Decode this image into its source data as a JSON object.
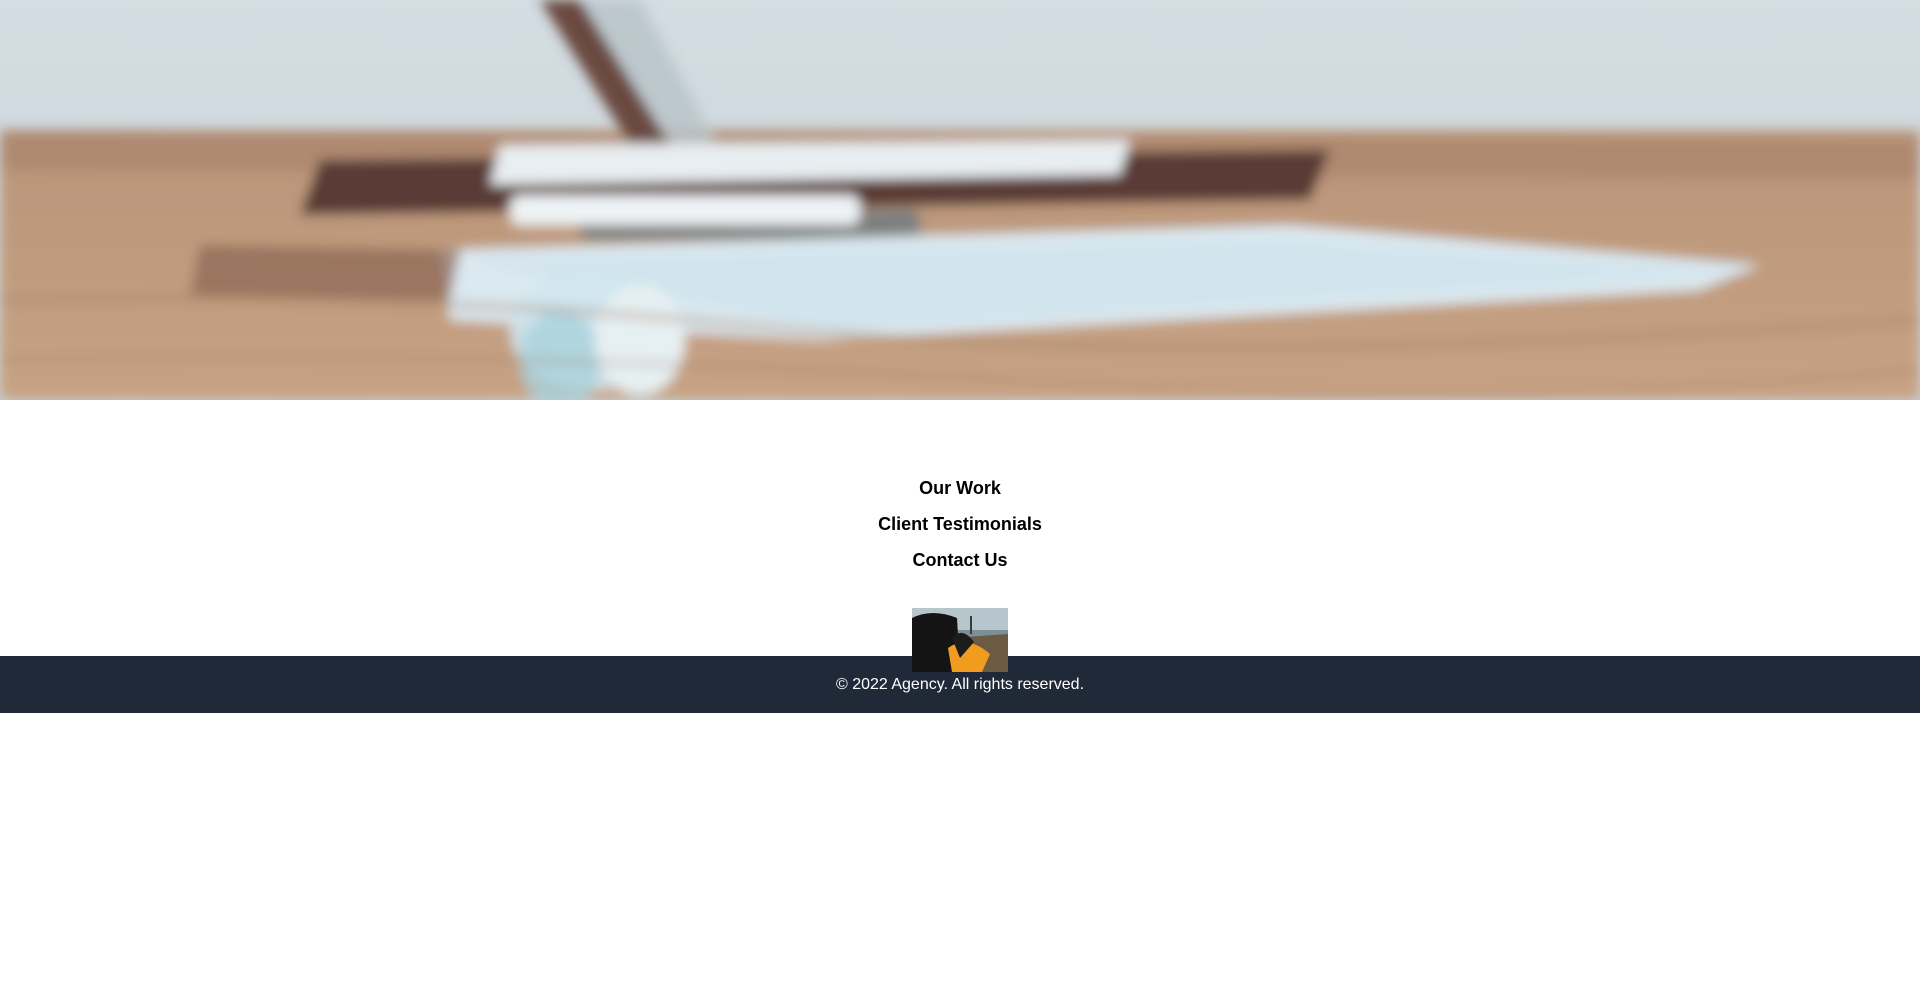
{
  "hero": {
    "image": "blurred-desk-laptop-photo"
  },
  "nav": {
    "items": [
      {
        "label": "Our Work"
      },
      {
        "label": "Client Testimonials"
      },
      {
        "label": "Contact Us"
      }
    ]
  },
  "thumbnail": {
    "image": "person-orange-jacket-photo"
  },
  "footer": {
    "copyright": "© 2022 Agency. All rights reserved."
  },
  "colors": {
    "footer_bg": "#1f2937",
    "footer_text": "#ffffff",
    "nav_text": "#000000",
    "page_bg": "#ffffff"
  }
}
